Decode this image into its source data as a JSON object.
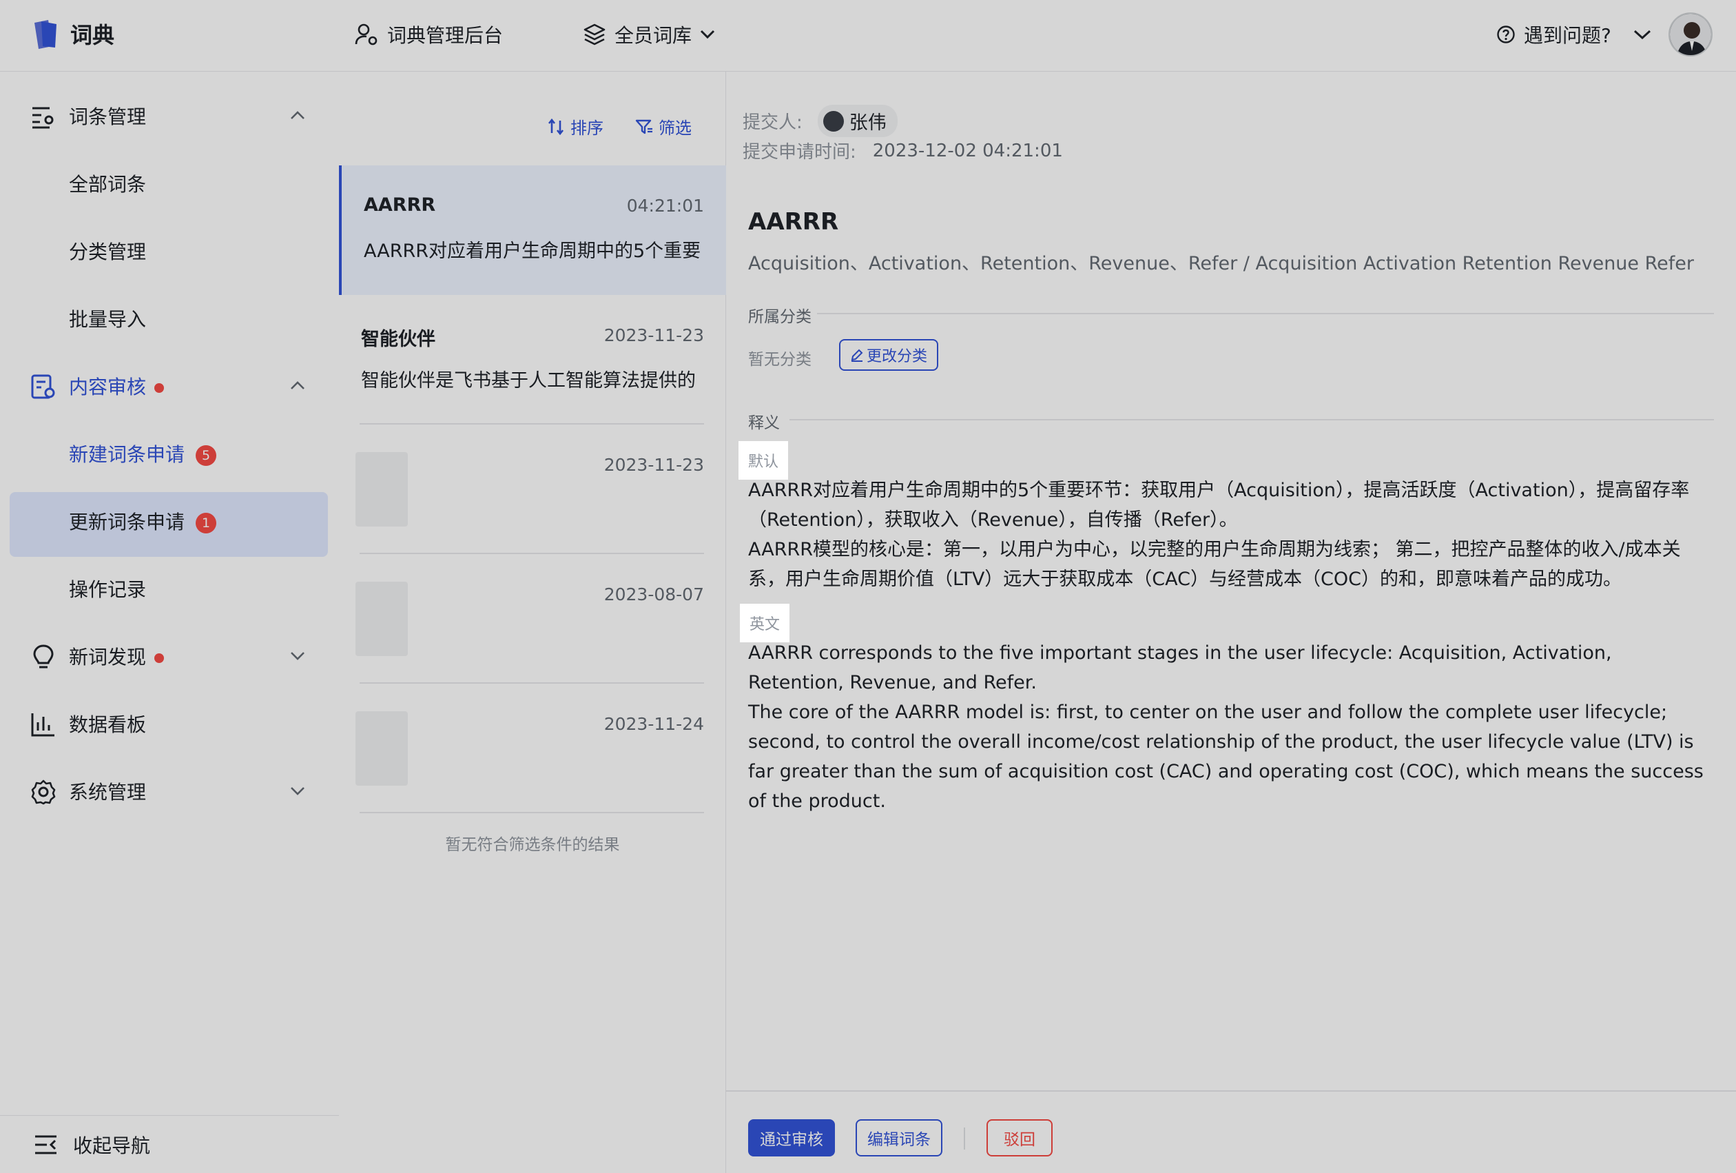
{
  "app": {
    "title": "词典",
    "admin_label": "词典管理后台",
    "library_label": "全员词库",
    "help_label": "遇到问题?"
  },
  "sidebar": {
    "groups": [
      {
        "label": "词条管理",
        "icon": "entry-manage-icon"
      },
      {
        "label": "内容审核",
        "icon": "content-review-icon"
      },
      {
        "label": "新词发现",
        "icon": "bulb-icon"
      },
      {
        "label": "数据看板",
        "icon": "bar-chart-icon"
      },
      {
        "label": "系统管理",
        "icon": "gear-icon"
      }
    ],
    "entry_items": [
      "全部词条",
      "分类管理",
      "批量导入"
    ],
    "review_items": [
      {
        "label": "新建词条申请",
        "badge": "5"
      },
      {
        "label": "更新词条申请",
        "badge": "1"
      },
      {
        "label": "操作记录",
        "badge": ""
      }
    ],
    "collapse_label": "收起导航"
  },
  "list": {
    "sort_label": "排序",
    "filter_label": "筛选",
    "rows": [
      {
        "title": "AARRR",
        "time": "04:21:01",
        "desc": "AARRR对应着用户生命周期中的5个重要"
      },
      {
        "title": "智能伙伴",
        "time": "2023-11-23",
        "desc": "智能伙伴是飞书基于人工智能算法提供的"
      },
      {
        "title": "",
        "time": "2023-11-23",
        "desc": ""
      },
      {
        "title": "",
        "time": "2023-08-07",
        "desc": ""
      },
      {
        "title": "",
        "time": "2023-11-24",
        "desc": ""
      }
    ],
    "empty_hint": "暂无符合筛选条件的结果"
  },
  "detail": {
    "submitter_label": "提交人:",
    "submitter_name": "张伟",
    "submit_time_label": "提交申请时间:",
    "submit_time": "2023-12-02 04:21:01",
    "word": "AARRR",
    "aliases": "Acquisition、Activation、Retention、Revenue、Refer / Acquisition Activation Retention Revenue Refer",
    "category_label": "所属分类",
    "category_empty": "暂无分类",
    "change_category": "更改分类",
    "definition_label": "释义",
    "default_tag": "默认",
    "default_text_1": "AARRR对应着用户生命周期中的5个重要环节：获取用户（Acquisition），提高活跃度（Activation），提高留存率（Retention），获取收入（Revenue），自传播（Refer）。",
    "default_text_2": "AARRR模型的核心是：第一，以用户为中心，以完整的用户生命周期为线索； 第二，把控产品整体的收入/成本关系，用户生命周期价值（LTV）远大于获取成本（CAC）与经营成本（COC）的和，即意味着产品的成功。",
    "english_tag": "英文",
    "english_text_1": "AARRR corresponds to the five important stages in the user lifecycle: Acquisition, Activation, Retention, Revenue, and Refer.",
    "english_text_2": "The core of the AARRR model is: first, to center on the user and follow the complete user lifecycle; second, to control the overall income/cost relationship of the product, the user lifecycle value (LTV) is far greater than the sum of acquisition cost (CAC) and operating cost (COC), which means the success of the product.",
    "approve": "通过审核",
    "edit": "编辑词条",
    "reject": "驳回"
  },
  "colors": {
    "accent": "#3354d8",
    "danger": "#f54a45",
    "active_bg": "#e0e9ff"
  }
}
